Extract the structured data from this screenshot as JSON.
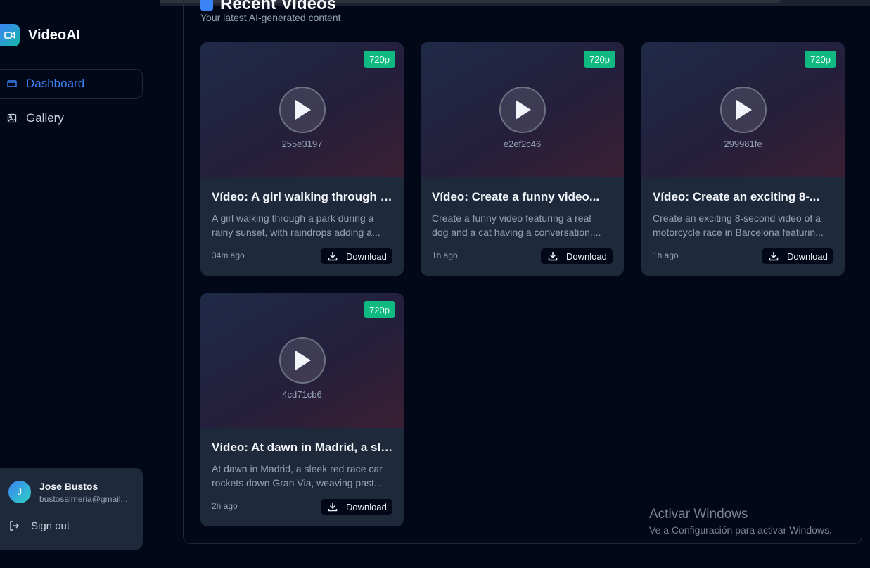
{
  "app": {
    "name": "VideoAI"
  },
  "sidebar": {
    "items": [
      {
        "label": "Dashboard",
        "icon": "folder-icon",
        "active": true
      },
      {
        "label": "Gallery",
        "icon": "image-icon",
        "active": false
      }
    ]
  },
  "user": {
    "initial": "J",
    "name": "Jose Bustos",
    "email": "bustosalmeria@gmail...",
    "sign_out_label": "Sign out"
  },
  "main": {
    "title": "Recent Videos",
    "subtitle": "Your latest AI-generated content"
  },
  "videos": [
    {
      "id": "255e3197",
      "resolution": "720p",
      "title": "Vídeo: A girl walking through a...",
      "desc_line1": "A girl walking through a park during a",
      "desc_line2": "rainy sunset, with raindrops adding a...",
      "time": "34m ago",
      "download_label": "Download"
    },
    {
      "id": "e2ef2c46",
      "resolution": "720p",
      "title": "Vídeo: Create a funny video...",
      "desc_line1": "Create a funny video featuring a real",
      "desc_line2": "dog and a cat having a conversation....",
      "time": "1h ago",
      "download_label": "Download"
    },
    {
      "id": "299981fe",
      "resolution": "720p",
      "title": "Vídeo: Create an exciting 8-...",
      "desc_line1": "Create an exciting 8-second video of a",
      "desc_line2": "motorcycle race in Barcelona featurin...",
      "time": "1h ago",
      "download_label": "Download"
    },
    {
      "id": "4cd71cb6",
      "resolution": "720p",
      "title": "Vídeo: At dawn in Madrid, a slee...",
      "desc_line1": "At dawn in Madrid, a sleek red race car",
      "desc_line2": "rockets down Gran Via, weaving past...",
      "time": "2h ago",
      "download_label": "Download"
    }
  ],
  "windows_watermark": {
    "line1": "Activar Windows",
    "line2": "Ve a Configuración para activar Windows."
  },
  "colors": {
    "accent": "#3b82f6",
    "badge": "#10b981",
    "background": "#020817",
    "card": "#1e293b"
  }
}
